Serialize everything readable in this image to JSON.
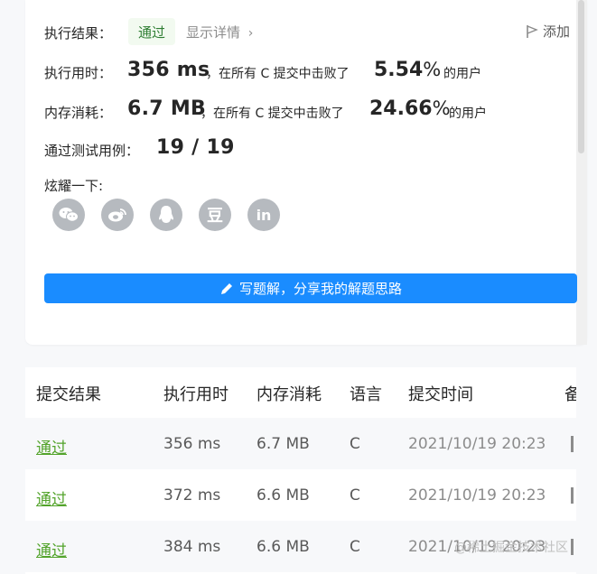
{
  "result": {
    "label": "执行结果：",
    "status": "通过",
    "details_link": "显示详情",
    "add_label": "添加"
  },
  "runtime": {
    "label": "执行用时：",
    "value": "356 ms",
    "beat_text": "，在所有 C 提交中击败了",
    "percent": "5.54",
    "percent_symbol": "%",
    "users": "的用户"
  },
  "memory": {
    "label": "内存消耗：",
    "value": "6.7 MB",
    "beat_text": "，在所有 C 提交中击败了",
    "percent": "24.66",
    "percent_symbol": "%",
    "users": "的用户"
  },
  "testcases": {
    "label": "通过测试用例：",
    "value": "19 / 19"
  },
  "share": {
    "label": "炫耀一下:",
    "icons": [
      "wechat-icon",
      "weibo-icon",
      "qq-icon",
      "douban-icon",
      "linkedin-icon"
    ],
    "douban_glyph": "豆",
    "linkedin_glyph": "in"
  },
  "write_button": {
    "label": "写题解，分享我的解题思路"
  },
  "submissions": {
    "headers": [
      "提交结果",
      "执行用时",
      "内存消耗",
      "语言",
      "提交时间",
      "备"
    ],
    "rows": [
      {
        "status": "通过",
        "runtime": "356 ms",
        "memory": "6.7 MB",
        "lang": "C",
        "time": "2021/10/19 20:23"
      },
      {
        "status": "通过",
        "runtime": "372 ms",
        "memory": "6.6 MB",
        "lang": "C",
        "time": "2021/10/19 20:23"
      },
      {
        "status": "通过",
        "runtime": "384 ms",
        "memory": "6.6 MB",
        "lang": "C",
        "time": "2021/10/19 20:23"
      }
    ]
  },
  "watermark": "@稀土掘金技术社区",
  "colors": {
    "accent": "#1a8cff",
    "success": "#52a32a",
    "icon_gray": "#b6babf"
  }
}
